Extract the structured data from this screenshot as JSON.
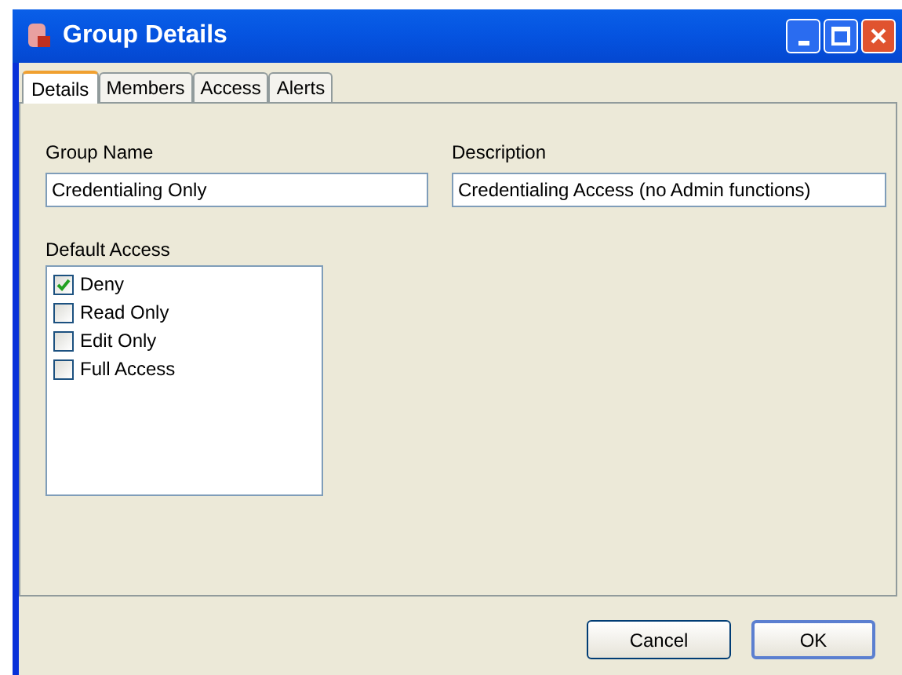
{
  "window": {
    "title": "Group Details"
  },
  "tabs": [
    {
      "label": "Details",
      "selected": true
    },
    {
      "label": "Members",
      "selected": false
    },
    {
      "label": "Access",
      "selected": false
    },
    {
      "label": "Alerts",
      "selected": false
    }
  ],
  "group_name": {
    "label": "Group Name",
    "value": "Credentialing Only"
  },
  "description": {
    "label": "Description",
    "value": "Credentialing Access (no Admin functions)"
  },
  "default_access": {
    "label": "Default Access",
    "options": [
      {
        "label": "Deny",
        "checked": true
      },
      {
        "label": "Read Only",
        "checked": false
      },
      {
        "label": "Edit Only",
        "checked": false
      },
      {
        "label": "Full Access",
        "checked": false
      }
    ]
  },
  "buttons": [
    {
      "label": "Cancel",
      "default": false
    },
    {
      "label": "OK",
      "default": true
    }
  ]
}
